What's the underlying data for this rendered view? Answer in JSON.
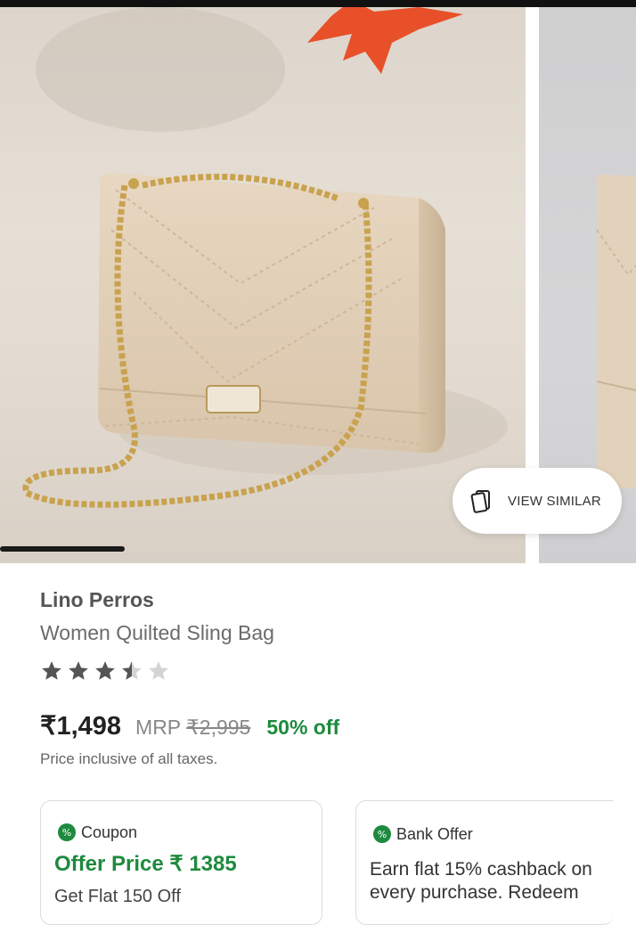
{
  "product": {
    "brand": "Lino Perros",
    "name": "Women Quilted Sling Bag",
    "rating": 3.5,
    "rating_max": 5,
    "price": "₹1,498",
    "mrp_label": "MRP",
    "mrp_value": "₹2,995",
    "discount": "50% off",
    "tax_note": "Price inclusive of all taxes."
  },
  "gallery": {
    "view_similar_label": "VIEW SIMILAR",
    "view_similar_icon": "cards-stack-icon"
  },
  "offers": {
    "coupon": {
      "tag": "Coupon",
      "offer_price": "Offer Price ₹ 1385",
      "sub_text": "Get Flat 150 Off"
    },
    "bank": {
      "tag": "Bank Offer",
      "description": "Earn flat 15% cashback on every purchase. Redeem"
    }
  },
  "colors": {
    "discount_green": "#1e8a3e",
    "star_filled": "#555555",
    "star_empty": "#d4d4d4"
  }
}
